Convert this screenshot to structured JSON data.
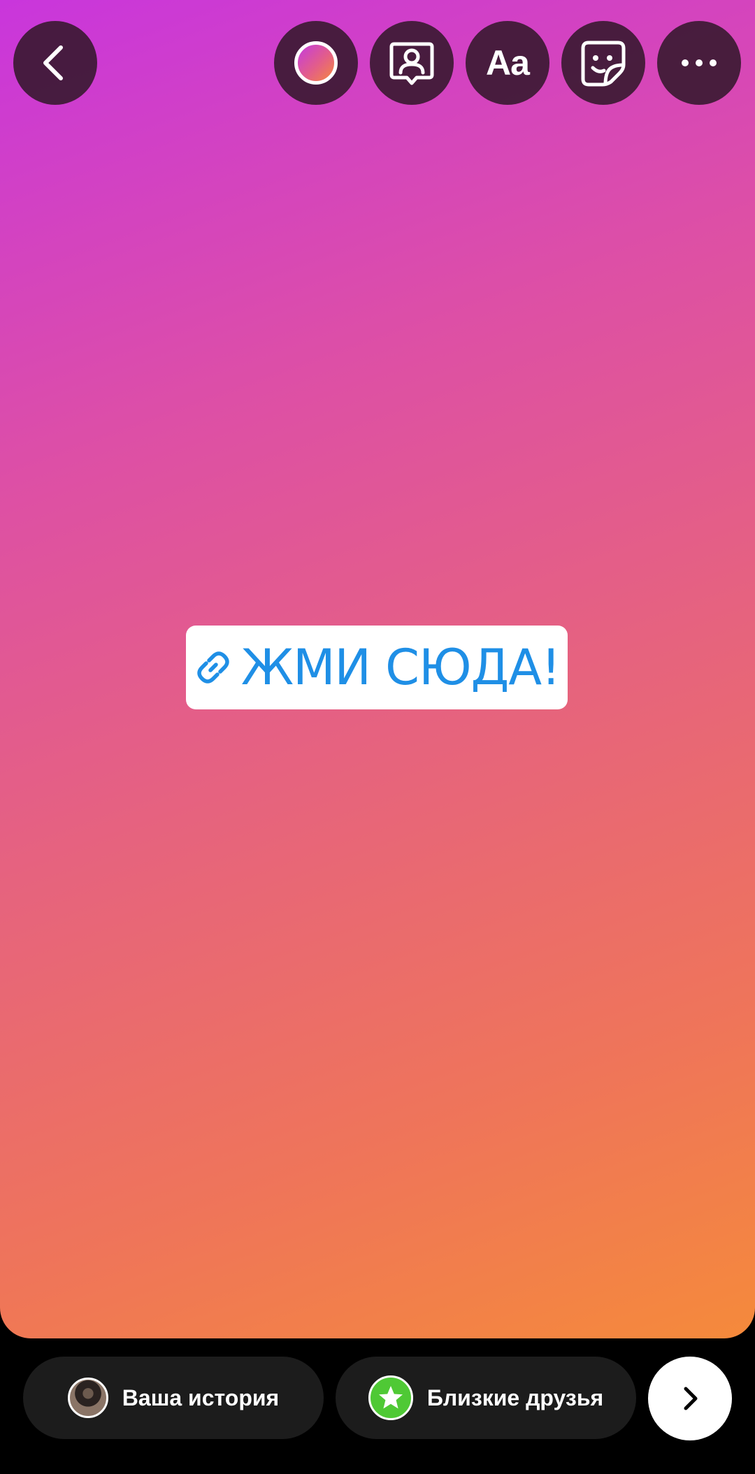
{
  "editor": {
    "background": {
      "gradient_start": "#c936dc",
      "gradient_end": "#f58a3b"
    },
    "toolbar": {
      "back": {
        "icon": "chevron-left-icon"
      },
      "color": {
        "icon": "color-picker-icon"
      },
      "mention": {
        "icon": "mention-person-icon"
      },
      "text": {
        "icon": "text-tool-icon",
        "label": "Aa"
      },
      "sticker": {
        "icon": "sticker-icon"
      },
      "more": {
        "icon": "more-horizontal-icon"
      }
    },
    "link_sticker": {
      "icon": "link-icon",
      "label": "ЖМИ СЮДА!",
      "text_color": "#1f8fe6"
    }
  },
  "share_bar": {
    "your_story": {
      "label": "Ваша история",
      "icon": "avatar"
    },
    "close_friends": {
      "label": "Близкие друзья",
      "icon": "star-icon",
      "accent": "#4fc935"
    },
    "next": {
      "icon": "chevron-right-icon"
    }
  }
}
